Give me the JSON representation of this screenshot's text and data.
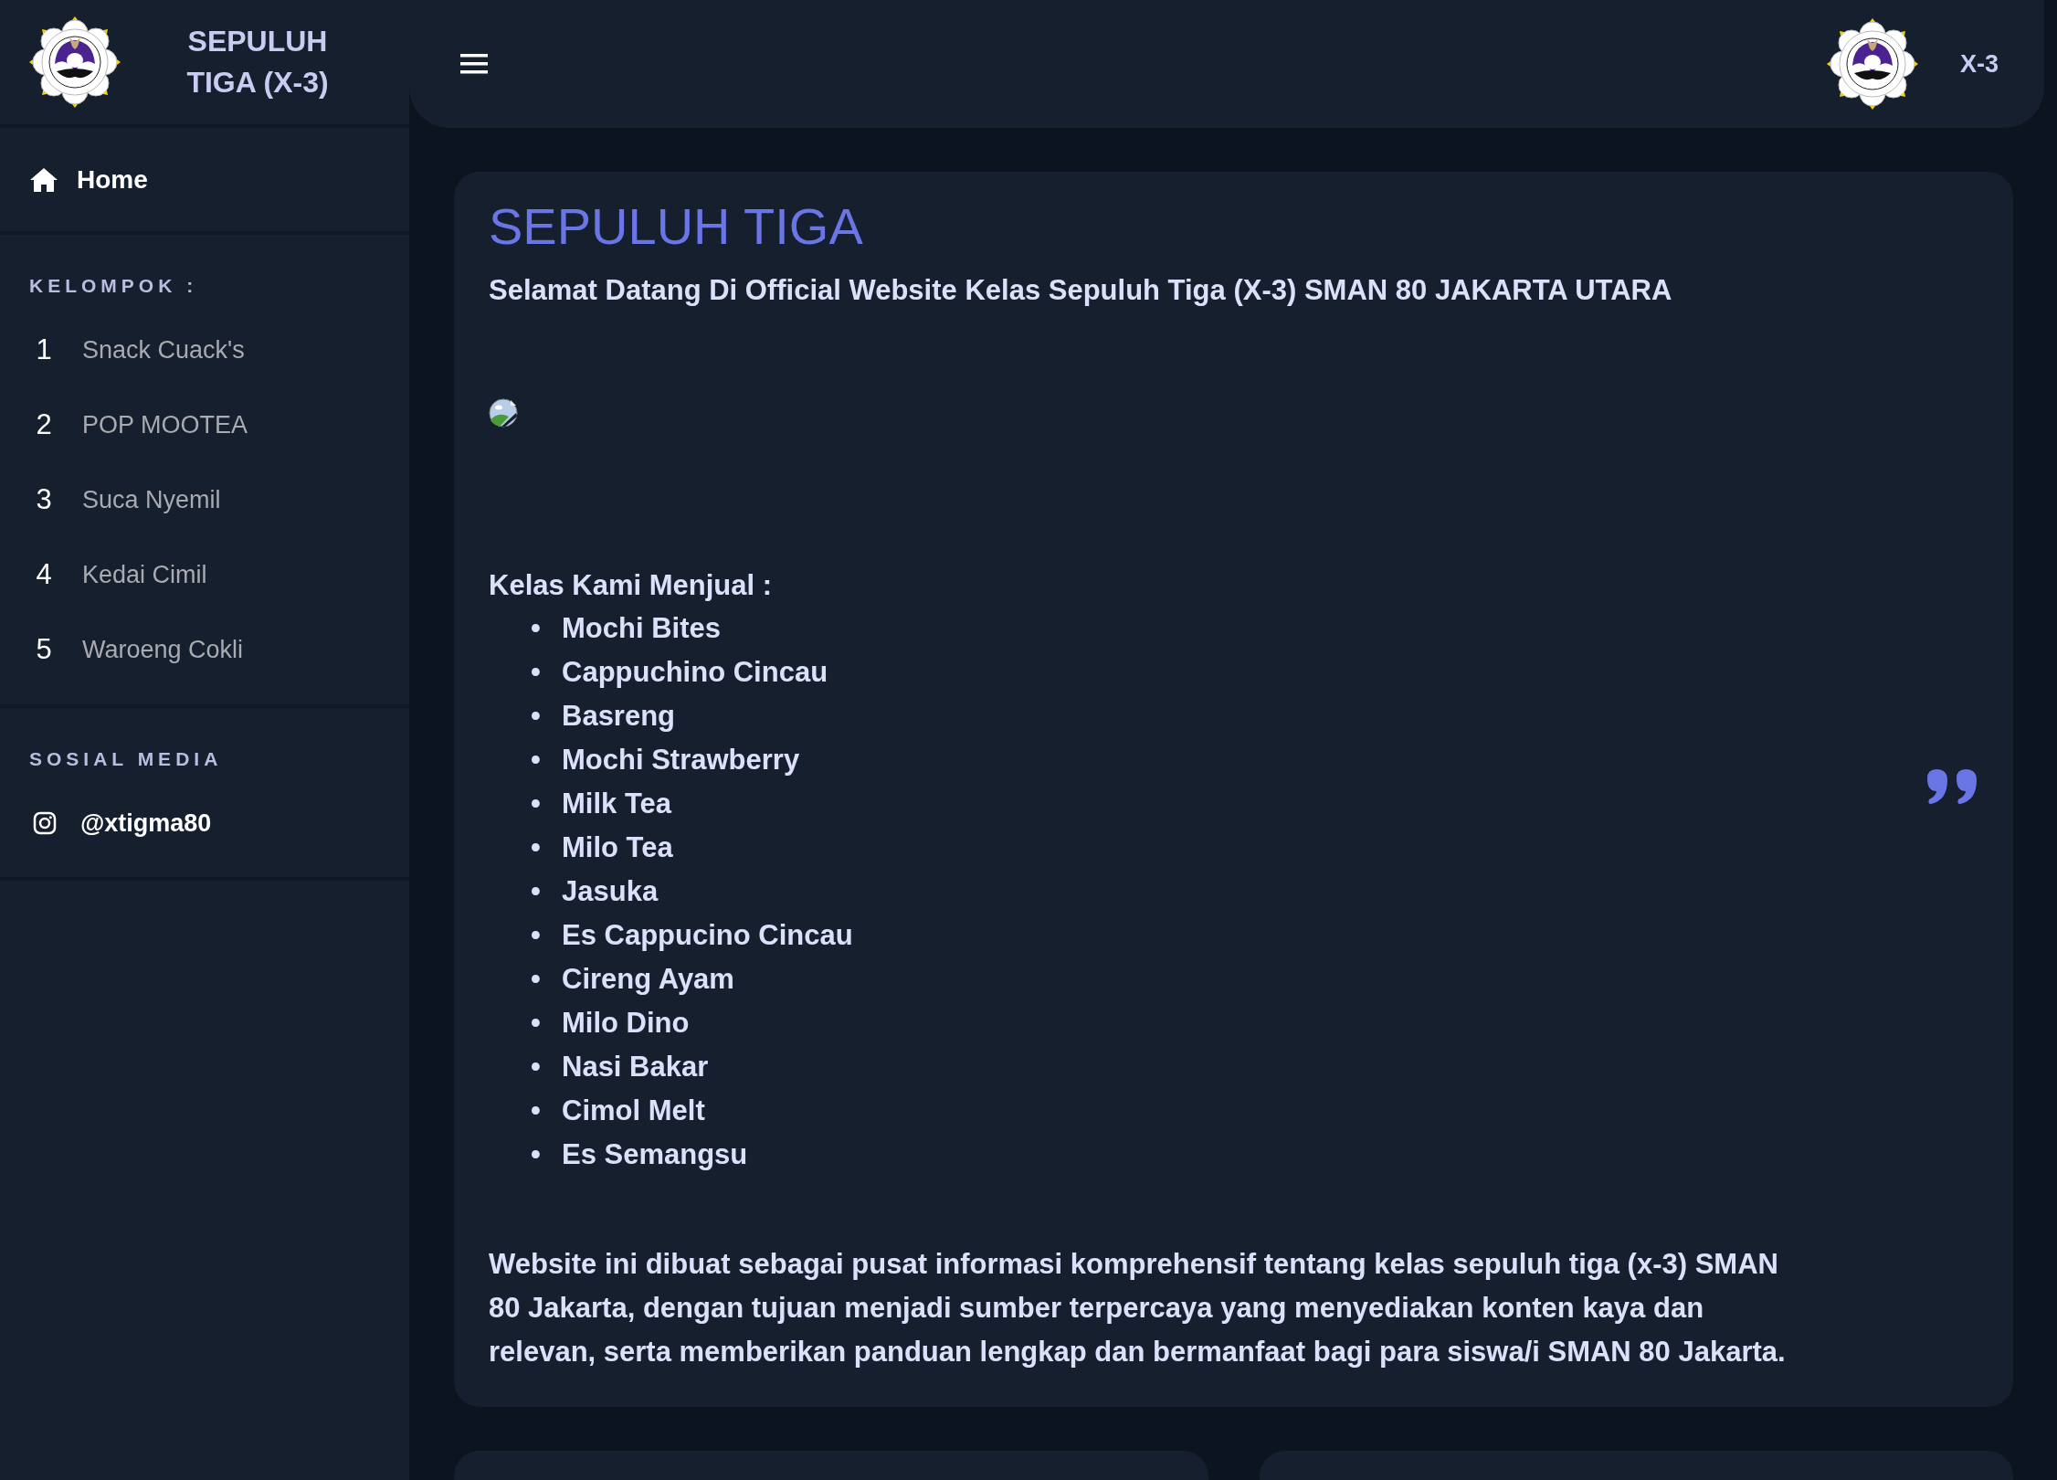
{
  "brand": {
    "title": "SEPULUH TIGA (X-3)"
  },
  "header": {
    "user_label": "X-3"
  },
  "sidebar": {
    "home": {
      "label": "Home"
    },
    "sections": [
      {
        "heading": "KELOMPOK :",
        "items": [
          {
            "kind": "numbered",
            "number": "1",
            "label": "Snack Cuack's"
          },
          {
            "kind": "numbered",
            "number": "2",
            "label": "POP MOOTEA"
          },
          {
            "kind": "numbered",
            "number": "3",
            "label": "Suca Nyemil"
          },
          {
            "kind": "numbered",
            "number": "4",
            "label": "Kedai Cimil"
          },
          {
            "kind": "numbered",
            "number": "5",
            "label": "Waroeng Cokli"
          }
        ]
      },
      {
        "heading": "SOSIAL MEDIA",
        "items": [
          {
            "kind": "instagram",
            "label": "@xtigma80"
          }
        ]
      }
    ]
  },
  "main": {
    "title": "SEPULUH TIGA",
    "subtitle": "Selamat Datang Di Official Website Kelas Sepuluh Tiga (X-3) SMAN 80 JAKARTA UTARA",
    "intro": "Kelas Kami Menjual :",
    "products": [
      {
        "marker": "•",
        "label": "Mochi Bites"
      },
      {
        "marker": "•",
        "label": "Cappuchino Cincau"
      },
      {
        "marker": "•",
        "label": "Basreng"
      },
      {
        "marker": "•",
        "label": "Mochi Strawberry"
      },
      {
        "marker": "•",
        "label": "Milk Tea"
      },
      {
        "marker": "•",
        "label": "Milo Tea"
      },
      {
        "marker": "•",
        "label": "Jasuka"
      },
      {
        "marker": "•",
        "label": "Es Cappucino Cincau"
      },
      {
        "marker": "•",
        "label": "Cireng Ayam"
      },
      {
        "marker": "•",
        "label": "Milo Dino"
      },
      {
        "marker": "•",
        "label": "Nasi Bakar"
      },
      {
        "marker": "•",
        "label": "Cimol Melt"
      },
      {
        "marker": "•",
        "label": "Es Semangsu"
      }
    ],
    "description": "Website ini dibuat sebagai pusat informasi komprehensif tentang kelas sepuluh tiga (x-3) SMAN 80 Jakarta, dengan tujuan menjadi sumber terpercaya yang menyediakan konten kaya dan relevan, serta memberikan panduan lengkap dan bermanfaat bagi para siswa/i SMAN 80 Jakarta."
  }
}
